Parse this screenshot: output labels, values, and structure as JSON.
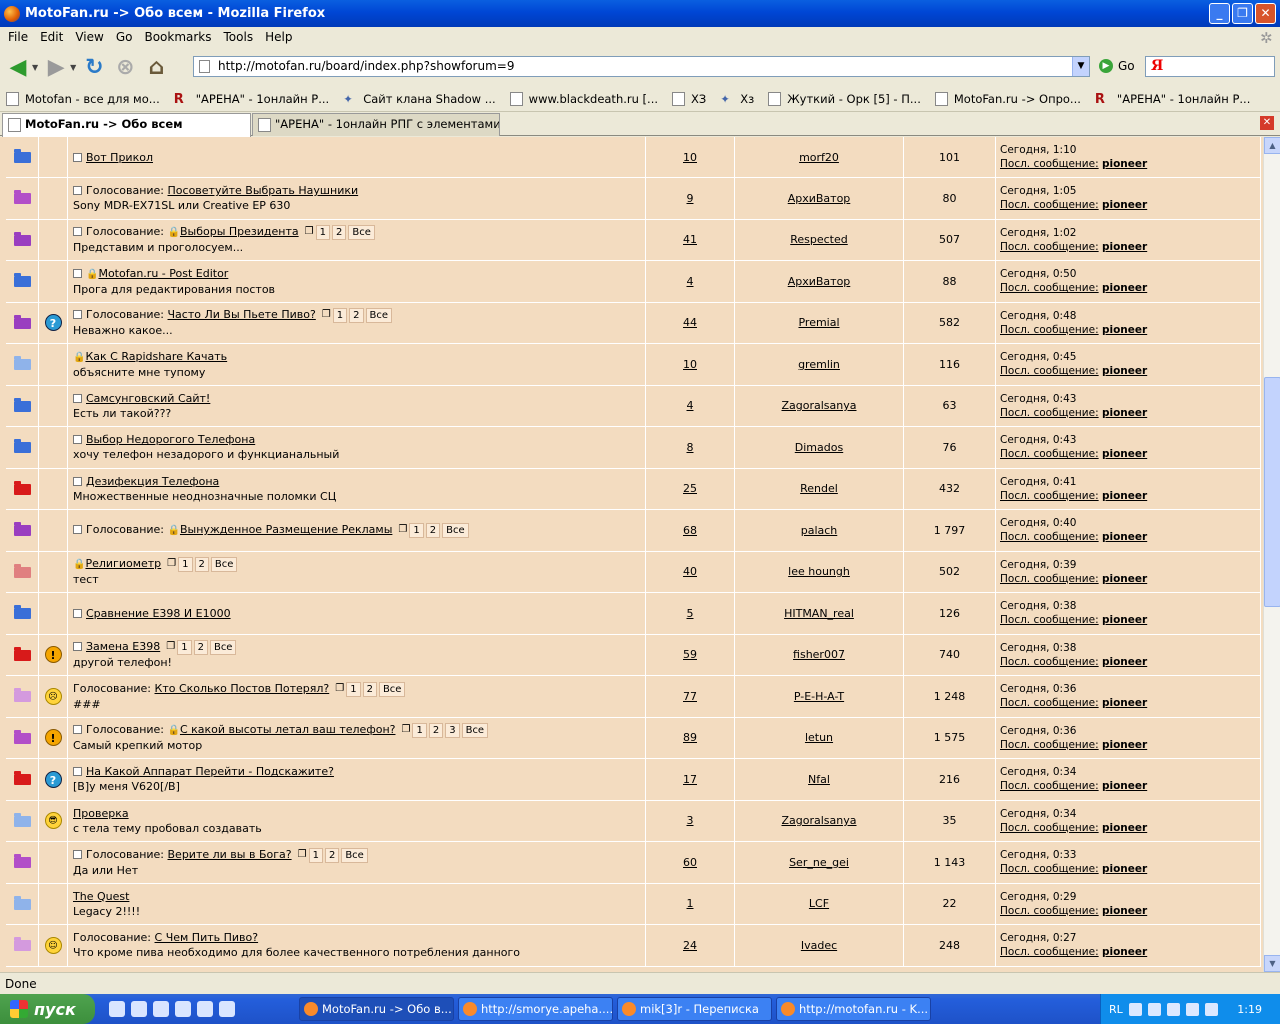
{
  "window": {
    "title": "MotoFan.ru -> Обо всем - Mozilla Firefox"
  },
  "menu": [
    "File",
    "Edit",
    "View",
    "Go",
    "Bookmarks",
    "Tools",
    "Help"
  ],
  "url": "http://motofan.ru/board/index.php?showforum=9",
  "go_label": "Go",
  "search_logo": "Я",
  "bookmarks": [
    {
      "label": "Motofan - все для мо...",
      "icon": "page-icon"
    },
    {
      "label": "\"АРЕНА\" - 1онлайн Р...",
      "icon": "arena-icon"
    },
    {
      "label": "Сайт клана Shadow ...",
      "icon": "clan-icon"
    },
    {
      "label": "www.blackdeath.ru [...",
      "icon": "page-icon"
    },
    {
      "label": "ХЗ",
      "icon": "page-icon"
    },
    {
      "label": "Хз",
      "icon": "joomla-icon"
    },
    {
      "label": "Жуткий - Орк [5] - П...",
      "icon": "page-icon"
    },
    {
      "label": "MotoFan.ru -> Опро...",
      "icon": "page-icon"
    },
    {
      "label": "\"АРЕНА\" - 1онлайн Р...",
      "icon": "arena-icon"
    }
  ],
  "tabs": [
    {
      "label": "MotoFan.ru -> Обо всем",
      "active": true
    },
    {
      "label": "\"АРЕНА\" - 1онлайн РПГ с элементами стра...",
      "active": false
    }
  ],
  "last_post_prefix": "Посл. сообщение:",
  "topics": [
    {
      "folder": "#3a6fd8",
      "emoticon": "",
      "prefix": "",
      "title": "Вот Прикол",
      "lock": false,
      "pages": [],
      "desc": "",
      "replies": "10",
      "author": "morf20",
      "views": "101",
      "time": "Сегодня, 1:10",
      "last": "pioneer",
      "icon": true
    },
    {
      "folder": "#b24ec8",
      "emoticon": "",
      "prefix": "Голосование:",
      "title": "Посоветуйте Выбрать Наушники",
      "lock": false,
      "pages": [],
      "desc": "Sony MDR-EX71SL или Creative EP 630",
      "replies": "9",
      "author": "АрхиВатор",
      "views": "80",
      "time": "Сегодня, 1:05",
      "last": "pioneer",
      "icon": true
    },
    {
      "folder": "#9a3ec0",
      "emoticon": "",
      "prefix": "Голосование:",
      "title": "Выборы Президента",
      "lock": true,
      "pages": [
        "1",
        "2",
        "Все"
      ],
      "desc": "Представим и проголосуем...",
      "replies": "41",
      "author": "Respected",
      "views": "507",
      "time": "Сегодня, 1:02",
      "last": "pioneer",
      "icon": true
    },
    {
      "folder": "#3a6fd8",
      "emoticon": "",
      "prefix": "",
      "title": "Motofan.ru - Post Editor",
      "lock": true,
      "pages": [],
      "desc": "Прога для редактирования постов",
      "replies": "4",
      "author": "АрхиВатор",
      "views": "88",
      "time": "Сегодня, 0:50",
      "last": "pioneer",
      "icon": true
    },
    {
      "folder": "#9a3ec0",
      "emoticon": "?",
      "prefix": "Голосование:",
      "title": "Часто Ли Вы Пьете Пиво?",
      "lock": false,
      "pages": [
        "1",
        "2",
        "Все"
      ],
      "desc": "Неважно какое...",
      "replies": "44",
      "author": "Premial",
      "views": "582",
      "time": "Сегодня, 0:48",
      "last": "pioneer",
      "icon": true
    },
    {
      "folder": "#8fb3ea",
      "emoticon": "",
      "prefix": "",
      "title": "Как С Rapidshare Качать",
      "lock": true,
      "pages": [],
      "desc": "объясните мне тупому",
      "replies": "10",
      "author": "gremlin",
      "views": "116",
      "time": "Сегодня, 0:45",
      "last": "pioneer",
      "icon": false
    },
    {
      "folder": "#3a6fd8",
      "emoticon": "",
      "prefix": "",
      "title": "Самсунговский Сайт!",
      "lock": false,
      "pages": [],
      "desc": "Есть ли такой???",
      "replies": "4",
      "author": "Zagoralsanya",
      "views": "63",
      "time": "Сегодня, 0:43",
      "last": "pioneer",
      "icon": true
    },
    {
      "folder": "#3a6fd8",
      "emoticon": "",
      "prefix": "",
      "title": "Выбор Недорогого Телефона",
      "lock": false,
      "pages": [],
      "desc": "хочу телефон незадорого и функцианальный",
      "replies": "8",
      "author": "Dimados",
      "views": "76",
      "time": "Сегодня, 0:43",
      "last": "pioneer",
      "icon": true
    },
    {
      "folder": "#d81a1a",
      "emoticon": "",
      "prefix": "",
      "title": "Дезифекция Телефона",
      "lock": false,
      "pages": [],
      "desc": "Множественные неоднозначные поломки СЦ",
      "replies": "25",
      "author": "Rendel",
      "views": "432",
      "time": "Сегодня, 0:41",
      "last": "pioneer",
      "icon": true
    },
    {
      "folder": "#9a3ec0",
      "emoticon": "",
      "prefix": "Голосование:",
      "title": "Вынужденное Размещение Рекламы",
      "lock": true,
      "pages": [
        "1",
        "2",
        "Все"
      ],
      "desc": "",
      "replies": "68",
      "author": "palach",
      "views": "1 797",
      "time": "Сегодня, 0:40",
      "last": "pioneer",
      "icon": true
    },
    {
      "folder": "#e08080",
      "emoticon": "",
      "prefix": "",
      "title": "Религиометр",
      "lock": true,
      "pages": [
        "1",
        "2",
        "Все"
      ],
      "desc": "тест",
      "replies": "40",
      "author": "lee houngh",
      "views": "502",
      "time": "Сегодня, 0:39",
      "last": "pioneer",
      "icon": false
    },
    {
      "folder": "#3a6fd8",
      "emoticon": "",
      "prefix": "",
      "title": "Сравнение Е398 И Е1000",
      "lock": false,
      "pages": [],
      "desc": "",
      "replies": "5",
      "author": "HITMAN_real",
      "views": "126",
      "time": "Сегодня, 0:38",
      "last": "pioneer",
      "icon": true
    },
    {
      "folder": "#d81a1a",
      "emoticon": "!",
      "prefix": "",
      "title": "Замена Е398",
      "lock": false,
      "pages": [
        "1",
        "2",
        "Все"
      ],
      "desc": "другой телефон!",
      "replies": "59",
      "author": "fisher007",
      "views": "740",
      "time": "Сегодня, 0:38",
      "last": "pioneer",
      "icon": true
    },
    {
      "folder": "#d49ade",
      "emoticon": ":(",
      "prefix": "Голосование:",
      "title": "Кто Сколько Постов Потерял?",
      "lock": false,
      "pages": [
        "1",
        "2",
        "Все"
      ],
      "desc": "###",
      "replies": "77",
      "author": "P-E-H-A-T",
      "views": "1 248",
      "time": "Сегодня, 0:36",
      "last": "pioneer",
      "icon": false
    },
    {
      "folder": "#b24ec8",
      "emoticon": "!",
      "prefix": "Голосование:",
      "title": "С какой высоты летал ваш телефон?",
      "lock": true,
      "pages": [
        "1",
        "2",
        "3",
        "Все"
      ],
      "desc": "Самый крепкий мотор",
      "replies": "89",
      "author": "letun",
      "views": "1 575",
      "time": "Сегодня, 0:36",
      "last": "pioneer",
      "icon": true
    },
    {
      "folder": "#d81a1a",
      "emoticon": "?",
      "prefix": "",
      "title": "На Какой Аппарат Перейти - Подскажите?",
      "lock": false,
      "pages": [],
      "desc": "[B]у меня V620[/B]",
      "replies": "17",
      "author": "Nfal",
      "views": "216",
      "time": "Сегодня, 0:34",
      "last": "pioneer",
      "icon": true
    },
    {
      "folder": "#8fb3ea",
      "emoticon": "8)",
      "prefix": "",
      "title": "Проверка",
      "lock": false,
      "pages": [],
      "desc": "с тела тему пробовал создавать",
      "replies": "3",
      "author": "Zagoralsanya",
      "views": "35",
      "time": "Сегодня, 0:34",
      "last": "pioneer",
      "icon": false
    },
    {
      "folder": "#b24ec8",
      "emoticon": "",
      "prefix": "Голосование:",
      "title": "Верите ли вы в Бога?",
      "lock": false,
      "pages": [
        "1",
        "2",
        "Все"
      ],
      "desc": "Да или Нет",
      "replies": "60",
      "author": "Ser_ne_gei",
      "views": "1 143",
      "time": "Сегодня, 0:33",
      "last": "pioneer",
      "icon": true
    },
    {
      "folder": "#8fb3ea",
      "emoticon": "",
      "prefix": "",
      "title": "The Quest",
      "lock": false,
      "pages": [],
      "desc": "Legacy 2!!!!",
      "replies": "1",
      "author": "LCF",
      "views": "22",
      "time": "Сегодня, 0:29",
      "last": "pioneer",
      "icon": false
    },
    {
      "folder": "#d49ade",
      "emoticon": ":)",
      "prefix": "Голосование:",
      "title": "С Чем Пить Пиво?",
      "lock": false,
      "pages": [],
      "desc": "Что кроме пива необходимо для более качественного потребления данного",
      "replies": "24",
      "author": "Ivadec",
      "views": "248",
      "time": "Сегодня, 0:27",
      "last": "pioneer",
      "icon": false
    }
  ],
  "status": "Done",
  "taskbar": {
    "start": "пуск",
    "tasks": [
      {
        "label": "MotoFan.ru -> Обо в...",
        "active": true
      },
      {
        "label": "http://smorye.apeha....",
        "active": false
      },
      {
        "label": "mik[3]r - Переписка",
        "active": false
      },
      {
        "label": "http://motofan.ru - K...",
        "active": false
      }
    ],
    "lang": "RL",
    "clock": "1:19"
  }
}
